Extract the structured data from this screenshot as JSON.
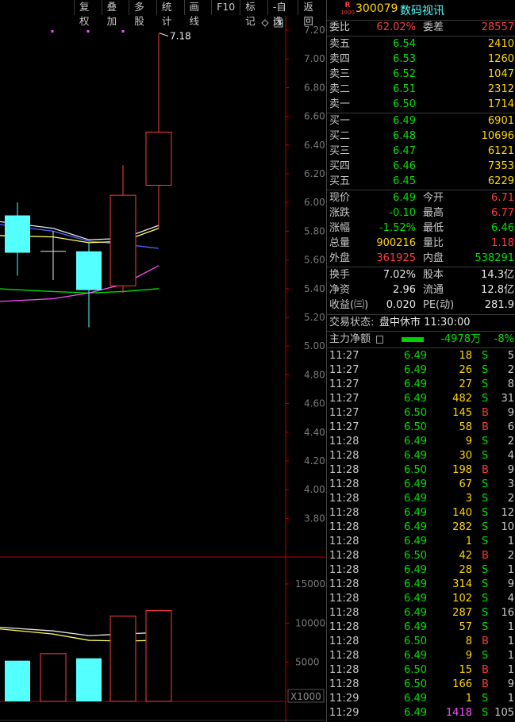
{
  "toolbar": [
    "复权",
    "叠加",
    "多股",
    "统计",
    "画线",
    "F10",
    "标记",
    "-自选",
    "返回"
  ],
  "axis": {
    "price_ticks": [
      "7.20",
      "7.00",
      "6.80",
      "6.60",
      "6.40",
      "6.20",
      "6.00",
      "5.80",
      "5.60",
      "5.40",
      "5.20",
      "5.00",
      "4.80",
      "4.60",
      "4.40",
      "4.20",
      "4.00",
      "3.80"
    ],
    "vol_ticks": [
      "15000",
      "10000",
      "5000"
    ],
    "vol_unit": "X1000",
    "max_label": "7.18"
  },
  "chart_data": {
    "type": "candlestick",
    "candles": [
      {
        "open": 5.91,
        "close": 5.65,
        "high": 6.0,
        "low": 5.49,
        "dir": "down"
      },
      {
        "open": 5.66,
        "close": 5.66,
        "high": 5.8,
        "low": 5.46,
        "dir": "flat"
      },
      {
        "open": 5.66,
        "close": 5.39,
        "high": 5.72,
        "low": 5.13,
        "dir": "down"
      },
      {
        "open": 5.42,
        "close": 6.05,
        "high": 6.26,
        "low": 5.37,
        "dir": "up"
      },
      {
        "open": 6.12,
        "close": 6.49,
        "high": 7.18,
        "low": 5.82,
        "dir": "up"
      }
    ],
    "volumes": [
      5200,
      6100,
      5500,
      10900,
      11600
    ],
    "ma_white": [
      5.87,
      5.82,
      5.74,
      5.75,
      5.84
    ],
    "ma_yellow": [
      5.77,
      5.76,
      5.72,
      5.73,
      5.82
    ],
    "ma_blue": [
      5.85,
      5.8,
      5.73,
      5.71,
      5.68
    ],
    "ma_magenta": [
      5.31,
      5.33,
      5.37,
      5.43,
      5.56
    ],
    "ma_green": [
      5.4,
      5.38,
      5.37,
      5.38,
      5.4
    ],
    "vma_white": [
      9500,
      9000,
      8400,
      8600,
      8800
    ],
    "vma_yellow": [
      9300,
      8600,
      7800,
      7700,
      7800
    ],
    "colors": {
      "up": "#ff3c3c",
      "down": "#54ffff",
      "axis": "#c00000"
    }
  },
  "header": {
    "badge_r": "R",
    "badge_n": "1000",
    "code": "300079",
    "name": "数码视讯"
  },
  "commission": {
    "ratio_label": "委比",
    "ratio": "62.02%",
    "diff_label": "委差",
    "diff": "28557"
  },
  "asks": [
    {
      "label": "卖五",
      "price": "6.54",
      "vol": "2410"
    },
    {
      "label": "卖四",
      "price": "6.53",
      "vol": "1260"
    },
    {
      "label": "卖三",
      "price": "6.52",
      "vol": "1047"
    },
    {
      "label": "卖二",
      "price": "6.51",
      "vol": "2312"
    },
    {
      "label": "卖一",
      "price": "6.50",
      "vol": "1714"
    }
  ],
  "bids": [
    {
      "label": "买一",
      "price": "6.49",
      "vol": "6901"
    },
    {
      "label": "买二",
      "price": "6.48",
      "vol": "10696"
    },
    {
      "label": "买三",
      "price": "6.47",
      "vol": "6121"
    },
    {
      "label": "买四",
      "price": "6.46",
      "vol": "7353"
    },
    {
      "label": "买五",
      "price": "6.45",
      "vol": "6229"
    }
  ],
  "quote": [
    {
      "l1": "现价",
      "v1": "6.49",
      "c1": "grn",
      "l2": "今开",
      "v2": "6.71",
      "c2": "red"
    },
    {
      "l1": "涨跌",
      "v1": "-0.10",
      "c1": "grn",
      "l2": "最高",
      "v2": "6.77",
      "c2": "red"
    },
    {
      "l1": "涨幅",
      "v1": "-1.52%",
      "c1": "grn",
      "l2": "最低",
      "v2": "6.46",
      "c2": "grn"
    },
    {
      "l1": "总量",
      "v1": "900216",
      "c1": "yel",
      "l2": "量比",
      "v2": "1.18",
      "c2": "red"
    },
    {
      "l1": "外盘",
      "v1": "361925",
      "c1": "red",
      "l2": "内盘",
      "v2": "538291",
      "c2": "grn"
    }
  ],
  "fin": [
    {
      "l1": "换手",
      "v1": "7.02%",
      "l2": "股本",
      "v2": "14.3亿"
    },
    {
      "l1": "净资",
      "v1": "2.96",
      "l2": "流通",
      "v2": "12.8亿"
    },
    {
      "l1": "收益(㈢)",
      "v1": "0.020",
      "l2": "PE(动)",
      "v2": "281.9"
    }
  ],
  "status": {
    "label": "交易状态:",
    "value": "盘中休市 11:30:00"
  },
  "mainflow": {
    "label": "主力净额",
    "value": "-4978万",
    "pct": "-8%"
  },
  "ticks": [
    [
      "11:27",
      "6.49",
      "18",
      "S",
      "5"
    ],
    [
      "11:27",
      "6.49",
      "26",
      "S",
      "2"
    ],
    [
      "11:27",
      "6.49",
      "27",
      "S",
      "8"
    ],
    [
      "11:27",
      "6.49",
      "482",
      "S",
      "31"
    ],
    [
      "11:27",
      "6.50",
      "145",
      "B",
      "9"
    ],
    [
      "11:27",
      "6.50",
      "58",
      "B",
      "6"
    ],
    [
      "11:28",
      "6.49",
      "9",
      "S",
      "2"
    ],
    [
      "11:28",
      "6.49",
      "30",
      "S",
      "4"
    ],
    [
      "11:28",
      "6.50",
      "198",
      "B",
      "9"
    ],
    [
      "11:28",
      "6.49",
      "67",
      "S",
      "3"
    ],
    [
      "11:28",
      "6.49",
      "3",
      "S",
      "2"
    ],
    [
      "11:28",
      "6.49",
      "140",
      "S",
      "12"
    ],
    [
      "11:28",
      "6.49",
      "282",
      "S",
      "10"
    ],
    [
      "11:28",
      "6.49",
      "1",
      "S",
      "1"
    ],
    [
      "11:28",
      "6.50",
      "42",
      "B",
      "2"
    ],
    [
      "11:28",
      "6.49",
      "28",
      "S",
      "1"
    ],
    [
      "11:28",
      "6.49",
      "314",
      "S",
      "9"
    ],
    [
      "11:28",
      "6.49",
      "102",
      "S",
      "4"
    ],
    [
      "11:28",
      "6.49",
      "287",
      "S",
      "16"
    ],
    [
      "11:28",
      "6.49",
      "57",
      "S",
      "1"
    ],
    [
      "11:28",
      "6.50",
      "8",
      "B",
      "1"
    ],
    [
      "11:28",
      "6.49",
      "9",
      "S",
      "1"
    ],
    [
      "11:28",
      "6.50",
      "15",
      "B",
      "1"
    ],
    [
      "11:28",
      "6.50",
      "166",
      "B",
      "9"
    ],
    [
      "11:29",
      "6.49",
      "1",
      "S",
      "1"
    ],
    [
      "11:29",
      "6.49",
      "1418",
      "S",
      "105"
    ]
  ]
}
